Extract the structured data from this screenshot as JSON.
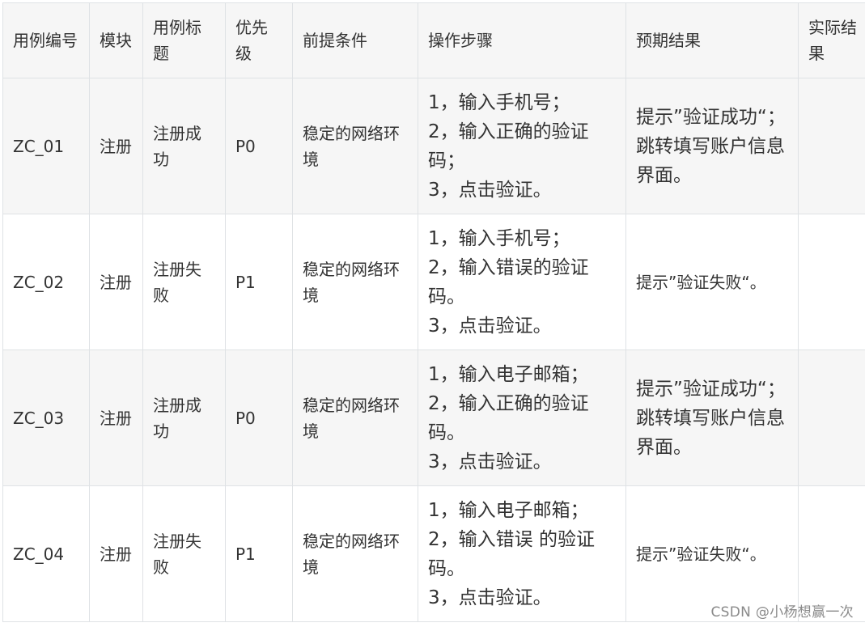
{
  "table": {
    "headers": [
      "用例编号",
      "模块",
      "用例标题",
      "优先级",
      "前提条件",
      "操作步骤",
      "预期结果",
      "实际结果"
    ],
    "rows": [
      {
        "id": "ZC_01",
        "module": "注册",
        "title": "注册成功",
        "priority": "P0",
        "precondition": "稳定的网络环境",
        "steps": [
          "1，输入手机号；",
          "2，输入正确的验证码；",
          "3，点击验证。"
        ],
        "expected": "提示”验证成功“；跳转填写账户信息界面。",
        "actual": ""
      },
      {
        "id": "ZC_02",
        "module": "注册",
        "title": "注册失败",
        "priority": "P1",
        "precondition": "稳定的网络环境",
        "steps": [
          "1，输入手机号；",
          "2，输入错误的验证码。",
          "3，点击验证。"
        ],
        "expected": "提示”验证失败“。",
        "actual": ""
      },
      {
        "id": "ZC_03",
        "module": "注册",
        "title": "注册成功",
        "priority": "P0",
        "precondition": "稳定的网络环境",
        "steps": [
          "1，输入电子邮箱；",
          "2，输入正确的验证码。",
          "3，点击验证。"
        ],
        "expected": "提示”验证成功“；跳转填写账户信息界面。",
        "actual": ""
      },
      {
        "id": "ZC_04",
        "module": "注册",
        "title": "注册失败",
        "priority": "P1",
        "precondition": "稳定的网络环境",
        "steps": [
          "1，输入电子邮箱；",
          "2，输入错误 的验证码。",
          "3，点击验证。"
        ],
        "expected": "提示”验证失败“。",
        "actual": ""
      }
    ]
  },
  "watermark": "CSDN @小杨想赢一次"
}
